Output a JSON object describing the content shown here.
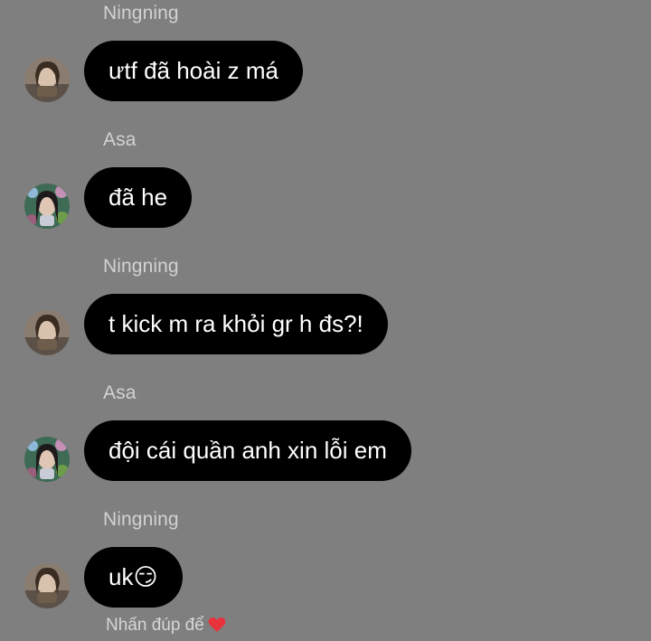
{
  "chat": {
    "messages": [
      {
        "sender": "Ningning",
        "text": "ưtf đã hoài z má",
        "avatar": "avatar-ningning"
      },
      {
        "sender": "Asa",
        "text": "đã he",
        "avatar": "avatar-asa"
      },
      {
        "sender": "Ningning",
        "text": "t kick m ra khỏi gr h đs?!",
        "avatar": "avatar-ningning"
      },
      {
        "sender": "Asa",
        "text": "đội cái quần anh xin lỗi em",
        "avatar": "avatar-asa"
      },
      {
        "sender": "Ningning",
        "text": "uk😏",
        "avatar": "avatar-ningning"
      }
    ],
    "reaction_hint": "Nhấn đúp để",
    "reaction_icon": "heart-icon"
  },
  "colors": {
    "background": "#7f7f7f",
    "bubble": "#000000",
    "bubble_text": "#ffffff",
    "sender_text": "#d2d2d2",
    "heart": "#e8323c"
  }
}
